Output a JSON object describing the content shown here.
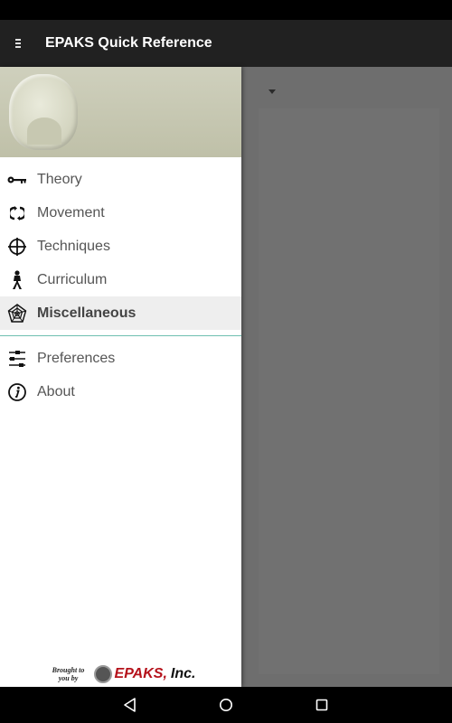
{
  "app": {
    "title": "EPAKS Quick Reference"
  },
  "icons": {
    "menu": "hamburger-icon",
    "theory": "key-icon",
    "movement": "rotate-arrows-icon",
    "techniques": "crosshair-icon",
    "curriculum": "person-stance-icon",
    "miscellaneous": "web-icon",
    "preferences": "sliders-icon",
    "about": "info-icon"
  },
  "drawer": {
    "items": [
      {
        "label": "Theory",
        "icon": "key-icon"
      },
      {
        "label": "Movement",
        "icon": "rotate-arrows-icon"
      },
      {
        "label": "Techniques",
        "icon": "crosshair-icon"
      },
      {
        "label": "Curriculum",
        "icon": "person-stance-icon"
      },
      {
        "label": "Miscellaneous",
        "icon": "web-icon",
        "selected": true
      }
    ],
    "secondary": [
      {
        "label": "Preferences",
        "icon": "sliders-icon"
      },
      {
        "label": "About",
        "icon": "info-icon"
      }
    ],
    "footer": {
      "brought_line1": "Brought to",
      "brought_line2": "you by",
      "brand": "EPAKS,",
      "brand_suffix": "Inc."
    }
  },
  "colors": {
    "app_bar": "#212121",
    "divider_accent": "#6fbfb0",
    "brand_red": "#b5121b",
    "scrim": "#6e6e6e"
  }
}
